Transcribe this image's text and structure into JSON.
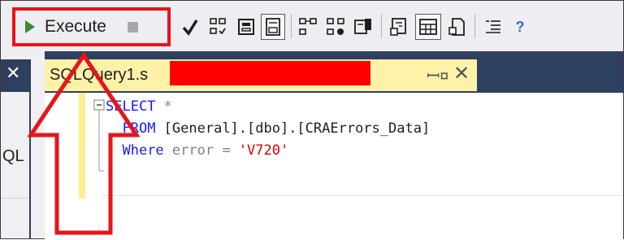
{
  "toolbar": {
    "execute_label": "Execute",
    "icons": [
      "play-icon",
      "stop-icon",
      "parse-icon",
      "display-plan-icon",
      "query-options-icon",
      "results-to-grid-icon",
      "text-results-icon",
      "include-plan-icon",
      "client-stats-icon",
      "results-file-icon",
      "results-grid-icon",
      "results-text-icon",
      "comment-icon",
      "uncomment-icon"
    ]
  },
  "dock": {
    "sql_label": "QL"
  },
  "tab": {
    "title": "SQLQuery1.s"
  },
  "editor": {
    "lines": [
      {
        "kw": "SELECT",
        "rest": " *"
      },
      {
        "kw": "FROM",
        "rest": " [General].[dbo].[CRAErrors_Data]"
      },
      {
        "kw": "Where",
        "rest": " error = ",
        "str": "'V720'"
      }
    ]
  },
  "colors": {
    "annotation_red": "#e8141a",
    "tab_background": "#fdf2a8",
    "dock_blue": "#2f3f5f",
    "keyword": "#1a1aff",
    "string": "#d10000"
  }
}
